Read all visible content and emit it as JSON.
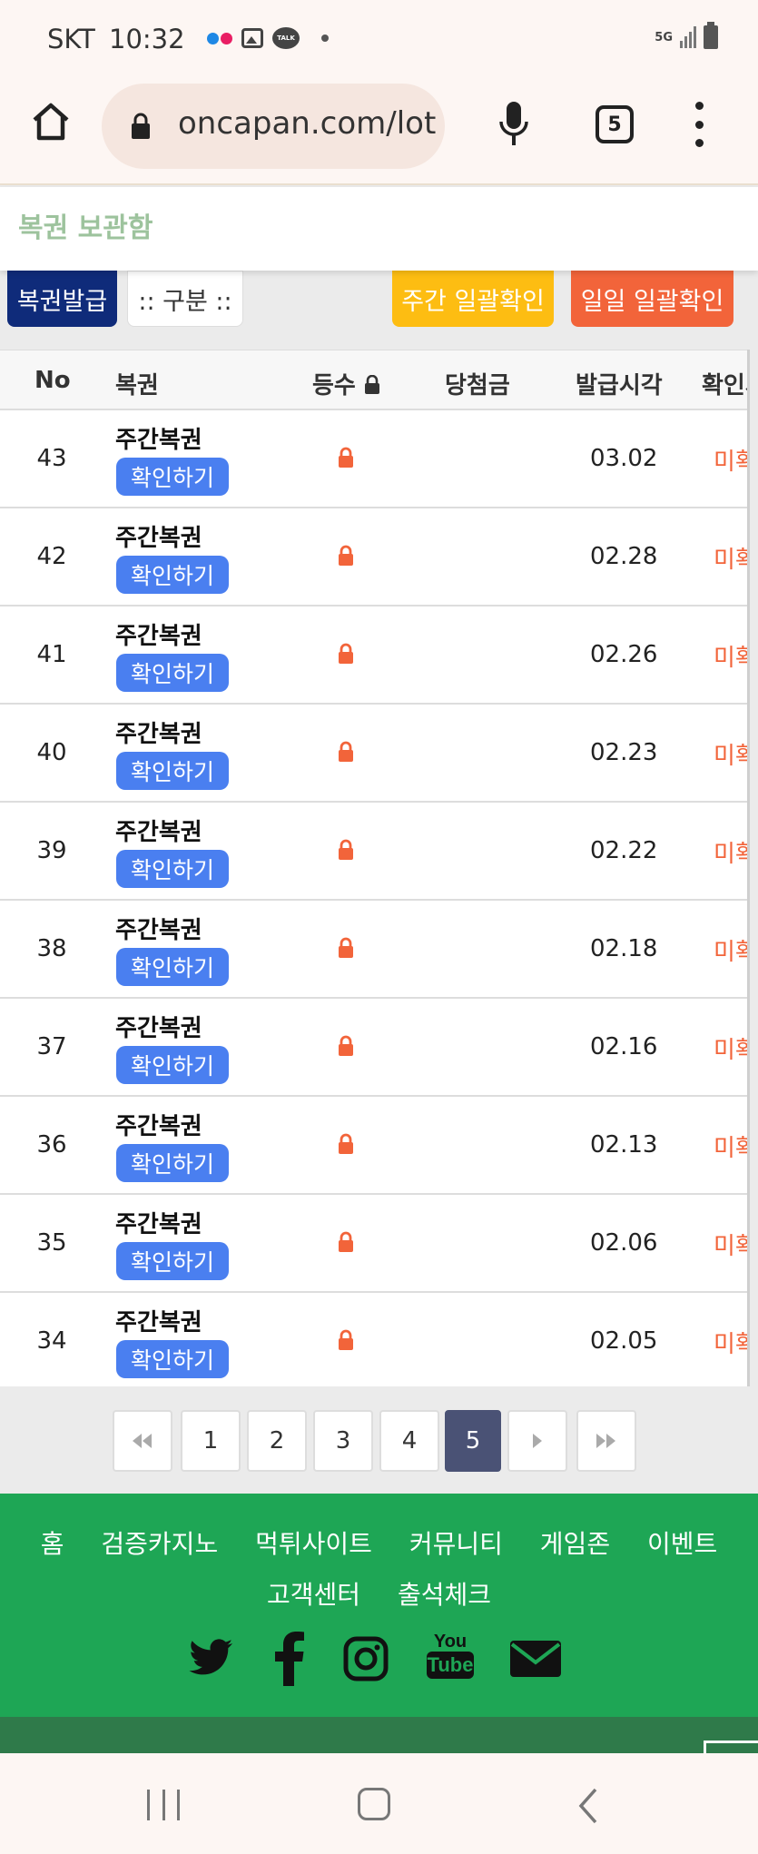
{
  "status_bar": {
    "carrier": "SKT",
    "time": "10:32",
    "talk_badge": "TALK",
    "network": "5G",
    "colors": {
      "dot_blue": "#1e88e5",
      "dot_red": "#e91e63"
    }
  },
  "browser": {
    "url": "oncapan.com/lot",
    "tab_count": "5"
  },
  "page": {
    "title": "복권 보관함"
  },
  "actions": {
    "issue": "복권발급",
    "filter": ":: 구분 ::",
    "weekly_check": "주간 일괄확인",
    "daily_check": "일일 일괄확인"
  },
  "table": {
    "headers": {
      "no": "No",
      "lottery": "복권",
      "rank": "등수",
      "prize": "당첨금",
      "issued": "발급시각",
      "confirm": "확인시"
    },
    "rows": [
      {
        "no": "43",
        "name": "주간복권",
        "check": "확인하기",
        "date": "03.02",
        "status": "미확"
      },
      {
        "no": "42",
        "name": "주간복권",
        "check": "확인하기",
        "date": "02.28",
        "status": "미확"
      },
      {
        "no": "41",
        "name": "주간복권",
        "check": "확인하기",
        "date": "02.26",
        "status": "미확"
      },
      {
        "no": "40",
        "name": "주간복권",
        "check": "확인하기",
        "date": "02.23",
        "status": "미확"
      },
      {
        "no": "39",
        "name": "주간복권",
        "check": "확인하기",
        "date": "02.22",
        "status": "미확"
      },
      {
        "no": "38",
        "name": "주간복권",
        "check": "확인하기",
        "date": "02.18",
        "status": "미확"
      },
      {
        "no": "37",
        "name": "주간복권",
        "check": "확인하기",
        "date": "02.16",
        "status": "미확"
      },
      {
        "no": "36",
        "name": "주간복권",
        "check": "확인하기",
        "date": "02.13",
        "status": "미확"
      },
      {
        "no": "35",
        "name": "주간복권",
        "check": "확인하기",
        "date": "02.06",
        "status": "미확"
      },
      {
        "no": "34",
        "name": "주간복권",
        "check": "확인하기",
        "date": "02.05",
        "status": "미확"
      }
    ]
  },
  "pagination": {
    "first": "«",
    "pages": [
      "1",
      "2",
      "3",
      "4",
      "5"
    ],
    "current": "5",
    "next": "›",
    "last": "»"
  },
  "footer": {
    "nav": [
      "홈",
      "검증카지노",
      "먹튀사이트",
      "커뮤니티",
      "게임존",
      "이벤트",
      "고객센터",
      "출석체크"
    ],
    "social": [
      "twitter-icon",
      "facebook-icon",
      "instagram-icon",
      "youtube-icon",
      "email-icon"
    ],
    "youtube_top": "You",
    "youtube_bottom": "Tube",
    "colors": {
      "footer_bg": "#1ea655"
    }
  },
  "colors": {
    "issue_btn": "#0f2b7a",
    "weekly_btn": "#fdbd12",
    "daily_btn": "#f2643a",
    "check_btn": "#4a7ff0",
    "lock": "#f2643a",
    "active_page": "#4a5275"
  }
}
